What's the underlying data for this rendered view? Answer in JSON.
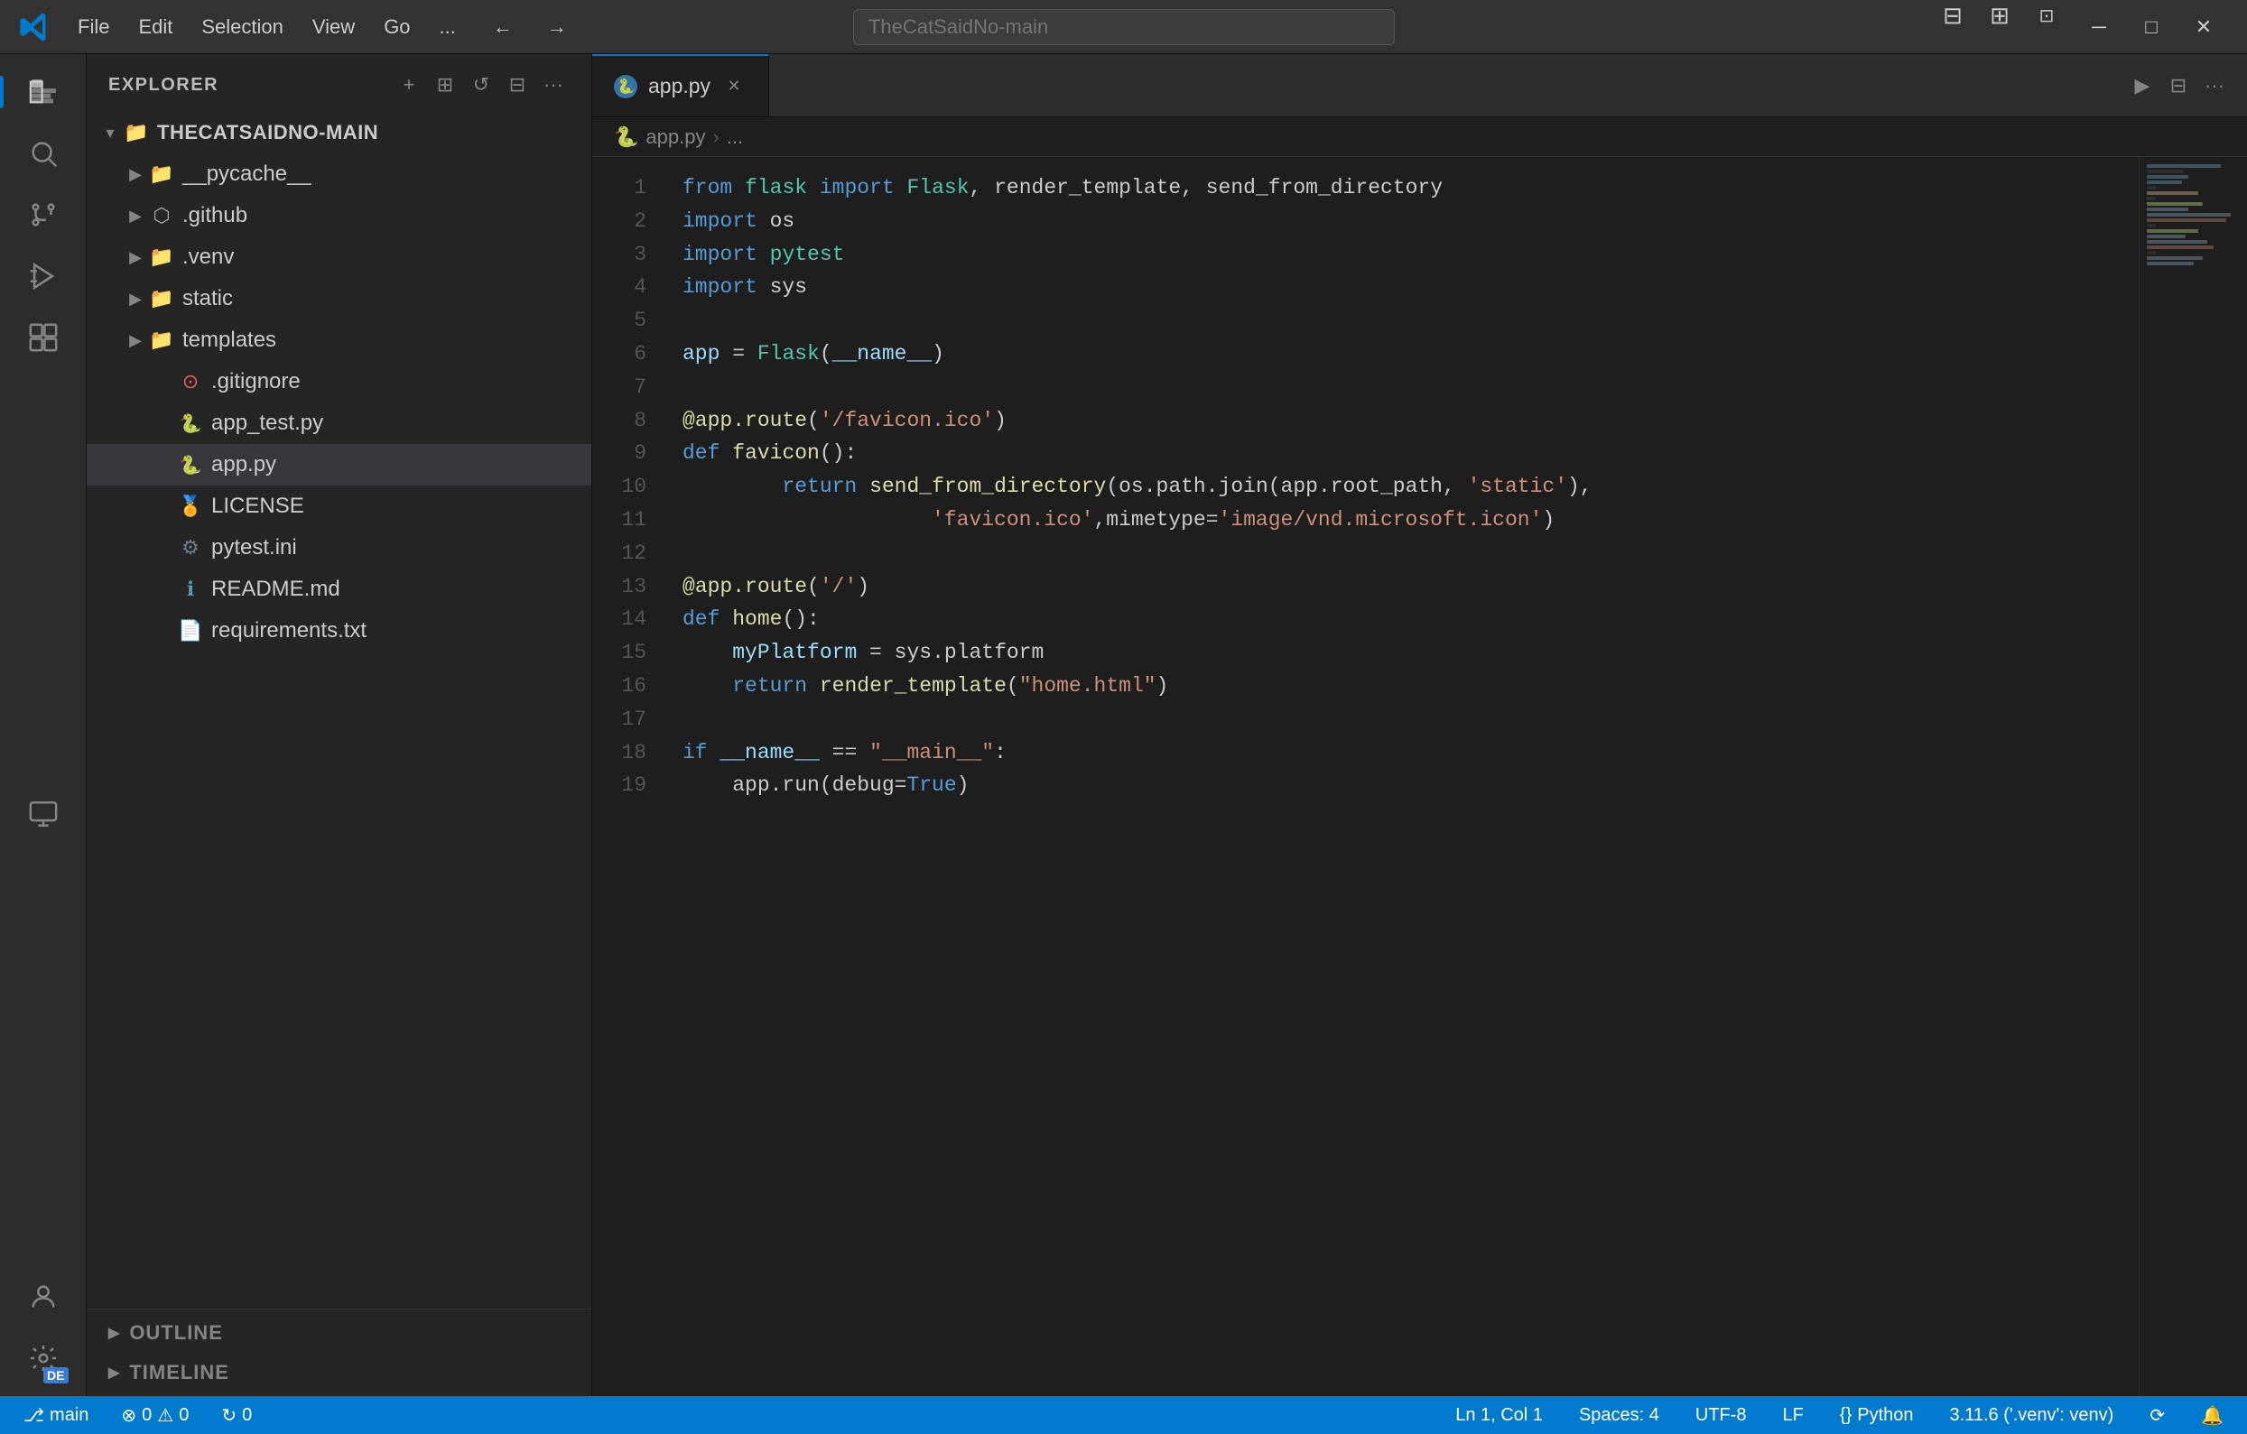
{
  "titlebar": {
    "menu_items": [
      "File",
      "Edit",
      "Selection",
      "View",
      "Go",
      "..."
    ],
    "search_placeholder": "TheCatSaidNo-main",
    "nav_back": "←",
    "nav_forward": "→"
  },
  "activity_bar": {
    "items": [
      {
        "name": "explorer",
        "icon": "⎙",
        "active": true
      },
      {
        "name": "search",
        "icon": "🔍"
      },
      {
        "name": "source-control",
        "icon": "⎇"
      },
      {
        "name": "extensions",
        "icon": "⊞"
      },
      {
        "name": "debug",
        "icon": "⚙"
      },
      {
        "name": "remote-explorer",
        "icon": "⬡"
      }
    ],
    "bottom_items": [
      {
        "name": "settings",
        "icon": "⚙",
        "label": "DE"
      }
    ]
  },
  "sidebar": {
    "title": "EXPLORER",
    "root_folder": "THECATSAIDNO-MAIN",
    "tree": [
      {
        "id": "pycache",
        "name": "__pycache__",
        "type": "folder",
        "depth": 1,
        "collapsed": true
      },
      {
        "id": "github",
        "name": ".github",
        "type": "folder",
        "depth": 1,
        "collapsed": true
      },
      {
        "id": "venv",
        "name": ".venv",
        "type": "folder",
        "depth": 1,
        "collapsed": true
      },
      {
        "id": "static",
        "name": "static",
        "type": "folder",
        "depth": 1,
        "collapsed": true
      },
      {
        "id": "templates",
        "name": "templates",
        "type": "folder",
        "depth": 1,
        "collapsed": true
      },
      {
        "id": "gitignore",
        "name": ".gitignore",
        "type": "gitignore",
        "depth": 1
      },
      {
        "id": "app_test",
        "name": "app_test.py",
        "type": "python",
        "depth": 1
      },
      {
        "id": "app",
        "name": "app.py",
        "type": "python",
        "depth": 1,
        "selected": true
      },
      {
        "id": "license",
        "name": "LICENSE",
        "type": "license",
        "depth": 1
      },
      {
        "id": "pytest_ini",
        "name": "pytest.ini",
        "type": "ini",
        "depth": 1
      },
      {
        "id": "readme",
        "name": "README.md",
        "type": "markdown",
        "depth": 1
      },
      {
        "id": "requirements",
        "name": "requirements.txt",
        "type": "text",
        "depth": 1
      }
    ],
    "bottom": [
      {
        "id": "outline",
        "label": "OUTLINE"
      },
      {
        "id": "timeline",
        "label": "TIMELINE"
      }
    ]
  },
  "editor": {
    "tab_label": "app.py",
    "tab_is_modified": false,
    "breadcrumb_file": "app.py",
    "breadcrumb_sep": "›",
    "breadcrumb_rest": "...",
    "code_lines": [
      {
        "num": 1,
        "tokens": [
          {
            "t": "kw",
            "v": "from"
          },
          {
            "t": "plain",
            "v": " "
          },
          {
            "t": "module",
            "v": "flask"
          },
          {
            "t": "plain",
            "v": " "
          },
          {
            "t": "kw",
            "v": "import"
          },
          {
            "t": "plain",
            "v": " "
          },
          {
            "t": "cls",
            "v": "Flask"
          },
          {
            "t": "plain",
            "v": ", render_template, send_from_directory"
          }
        ]
      },
      {
        "num": 2,
        "tokens": [
          {
            "t": "kw",
            "v": "import"
          },
          {
            "t": "plain",
            "v": " os"
          }
        ]
      },
      {
        "num": 3,
        "tokens": [
          {
            "t": "kw",
            "v": "import"
          },
          {
            "t": "plain",
            "v": " "
          },
          {
            "t": "module",
            "v": "pytest"
          }
        ]
      },
      {
        "num": 4,
        "tokens": [
          {
            "t": "kw",
            "v": "import"
          },
          {
            "t": "plain",
            "v": " sys"
          }
        ]
      },
      {
        "num": 5,
        "tokens": []
      },
      {
        "num": 6,
        "tokens": [
          {
            "t": "var",
            "v": "app"
          },
          {
            "t": "plain",
            "v": " = "
          },
          {
            "t": "cls",
            "v": "Flask"
          },
          {
            "t": "plain",
            "v": "("
          },
          {
            "t": "var",
            "v": "__name__"
          },
          {
            "t": "plain",
            "v": ")"
          }
        ]
      },
      {
        "num": 7,
        "tokens": []
      },
      {
        "num": 8,
        "tokens": [
          {
            "t": "decorator",
            "v": "@app.route"
          },
          {
            "t": "plain",
            "v": "("
          },
          {
            "t": "str",
            "v": "'/favicon.ico'"
          },
          {
            "t": "plain",
            "v": ")"
          }
        ]
      },
      {
        "num": 9,
        "tokens": [
          {
            "t": "kw",
            "v": "def"
          },
          {
            "t": "plain",
            "v": " "
          },
          {
            "t": "fn",
            "v": "favicon"
          },
          {
            "t": "plain",
            "v": "():"
          }
        ]
      },
      {
        "num": 10,
        "tokens": [
          {
            "t": "plain",
            "v": "        "
          },
          {
            "t": "kw",
            "v": "return"
          },
          {
            "t": "plain",
            "v": " "
          },
          {
            "t": "fn",
            "v": "send_from_directory"
          },
          {
            "t": "plain",
            "v": "(os.path.join(app.root_path, "
          },
          {
            "t": "str",
            "v": "'static'"
          },
          {
            "t": "plain",
            "v": "),"
          }
        ]
      },
      {
        "num": 11,
        "tokens": [
          {
            "t": "plain",
            "v": "                    "
          },
          {
            "t": "str",
            "v": "'favicon.ico'"
          },
          {
            "t": "plain",
            "v": ",mimetype="
          },
          {
            "t": "str",
            "v": "'image/vnd.microsoft.icon'"
          },
          {
            "t": "plain",
            "v": ")"
          }
        ]
      },
      {
        "num": 12,
        "tokens": []
      },
      {
        "num": 13,
        "tokens": [
          {
            "t": "decorator",
            "v": "@app.route"
          },
          {
            "t": "plain",
            "v": "("
          },
          {
            "t": "str",
            "v": "'/'"
          },
          {
            "t": "plain",
            "v": ")"
          }
        ]
      },
      {
        "num": 14,
        "tokens": [
          {
            "t": "kw",
            "v": "def"
          },
          {
            "t": "plain",
            "v": " "
          },
          {
            "t": "fn",
            "v": "home"
          },
          {
            "t": "plain",
            "v": "():"
          }
        ]
      },
      {
        "num": 15,
        "tokens": [
          {
            "t": "plain",
            "v": "    "
          },
          {
            "t": "var",
            "v": "myPlatform"
          },
          {
            "t": "plain",
            "v": " = sys.platform"
          }
        ]
      },
      {
        "num": 16,
        "tokens": [
          {
            "t": "plain",
            "v": "    "
          },
          {
            "t": "kw",
            "v": "return"
          },
          {
            "t": "plain",
            "v": " "
          },
          {
            "t": "fn",
            "v": "render_template"
          },
          {
            "t": "plain",
            "v": "("
          },
          {
            "t": "str",
            "v": "\"home.html\""
          },
          {
            "t": "plain",
            "v": ")"
          }
        ]
      },
      {
        "num": 17,
        "tokens": []
      },
      {
        "num": 18,
        "tokens": [
          {
            "t": "kw",
            "v": "if"
          },
          {
            "t": "plain",
            "v": " "
          },
          {
            "t": "var",
            "v": "__name__"
          },
          {
            "t": "plain",
            "v": " == "
          },
          {
            "t": "str",
            "v": "\"__main__\""
          },
          {
            "t": "plain",
            "v": ":"
          }
        ]
      },
      {
        "num": 19,
        "tokens": [
          {
            "t": "plain",
            "v": "    app.run(debug="
          },
          {
            "t": "bool",
            "v": "True"
          },
          {
            "t": "plain",
            "v": ")"
          }
        ]
      }
    ]
  },
  "status_bar": {
    "branch_icon": "⎇",
    "branch_name": "main",
    "errors_icon": "⊗",
    "errors_count": "0",
    "warnings_icon": "⚠",
    "warnings_count": "0",
    "remote_icon": "↻",
    "remote_count": "0",
    "line_col": "Ln 1, Col 1",
    "spaces": "Spaces: 4",
    "encoding": "UTF-8",
    "line_ending": "LF",
    "language_icon": "{}",
    "language": "Python",
    "version": "3.11.6 ('.venv': venv)",
    "sync_icon": "⟳",
    "bell_icon": "🔔"
  }
}
